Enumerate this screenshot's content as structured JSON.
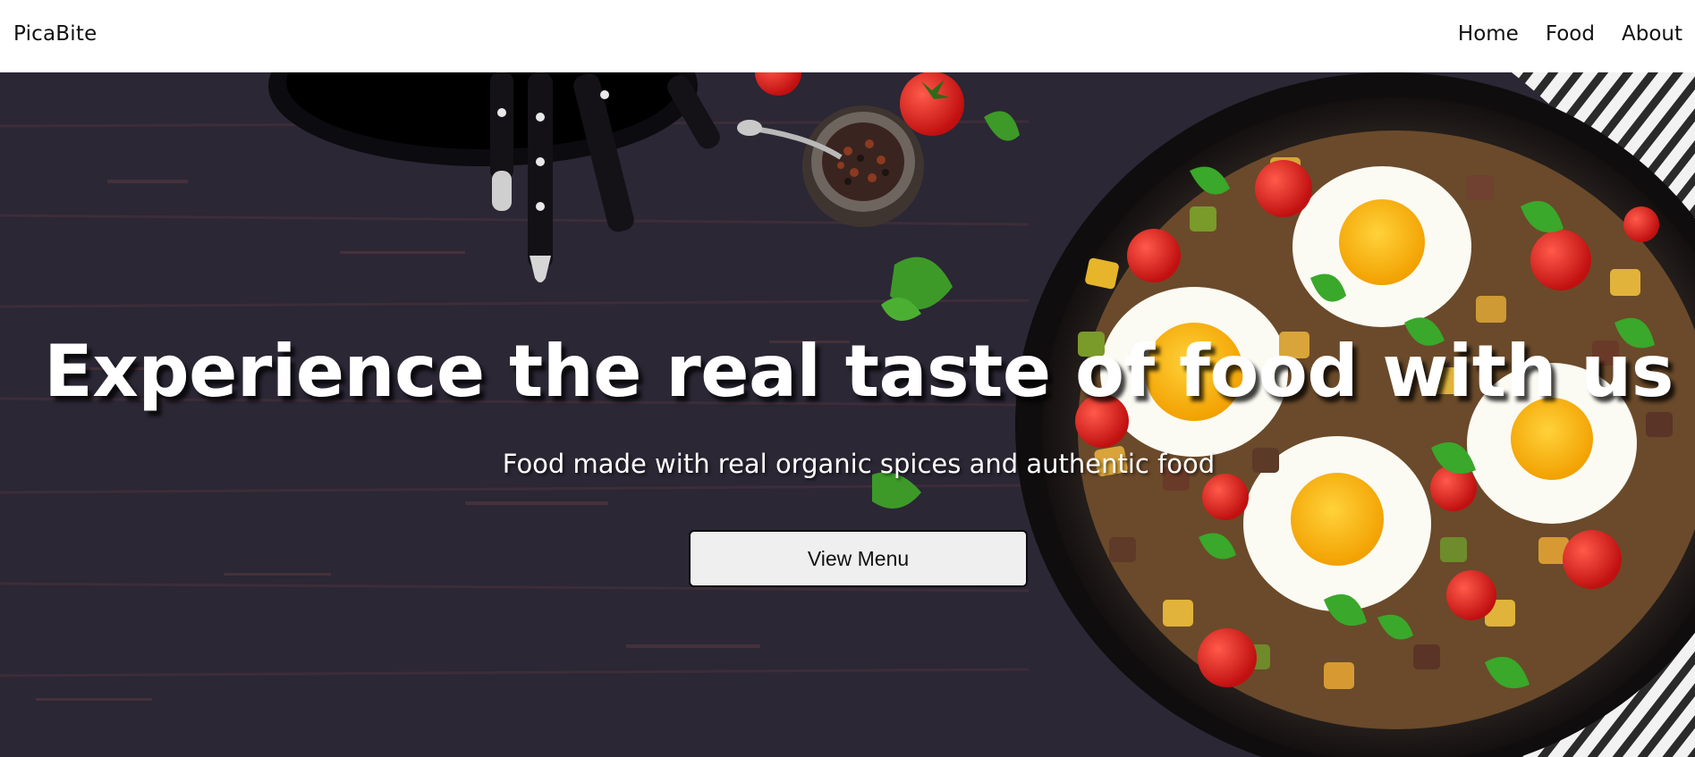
{
  "nav": {
    "brand": "PicaBite",
    "links": [
      {
        "label": "Home"
      },
      {
        "label": "Food"
      },
      {
        "label": "About"
      }
    ]
  },
  "hero": {
    "headline": "Experience the real taste of food with us",
    "subheadline": "Food made with real organic spices and authentic food",
    "cta_label": "View Menu"
  },
  "colors": {
    "background": "#2b2735",
    "navbar": "#ffffff",
    "text_dark": "#111111",
    "text_light": "#ffffff",
    "button_bg": "#efefef"
  }
}
